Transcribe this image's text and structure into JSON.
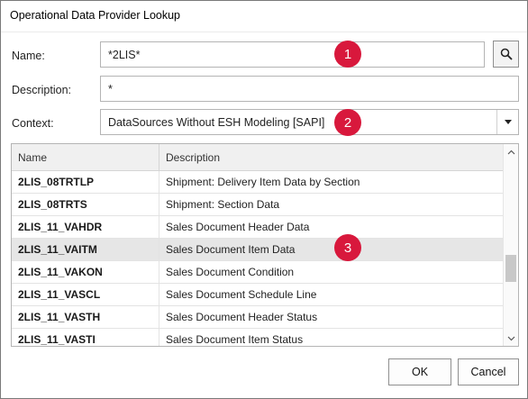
{
  "window": {
    "title": "Operational Data Provider Lookup"
  },
  "form": {
    "name_label": "Name:",
    "name_value": "*2LIS*",
    "description_label": "Description:",
    "description_value": "*",
    "context_label": "Context:",
    "context_value": "DataSources Without ESH Modeling [SAPI]"
  },
  "badges": [
    "1",
    "2",
    "3"
  ],
  "grid": {
    "columns": [
      "Name",
      "Description"
    ],
    "rows": [
      {
        "name": "2LIS_08TRTLP",
        "description": "Shipment: Delivery Item Data by Section"
      },
      {
        "name": "2LIS_08TRTS",
        "description": "Shipment: Section Data"
      },
      {
        "name": "2LIS_11_VAHDR",
        "description": "Sales Document Header Data"
      },
      {
        "name": "2LIS_11_VAITM",
        "description": "Sales Document Item Data",
        "selected": true
      },
      {
        "name": "2LIS_11_VAKON",
        "description": "Sales Document Condition"
      },
      {
        "name": "2LIS_11_VASCL",
        "description": "Sales Document Schedule Line"
      },
      {
        "name": "2LIS_11_VASTH",
        "description": "Sales Document Header Status"
      },
      {
        "name": "2LIS_11_VASTI",
        "description": "Sales Document Item Status"
      }
    ]
  },
  "buttons": {
    "ok": "OK",
    "cancel": "Cancel"
  },
  "icons": {
    "search": "search-icon",
    "dropdown": "chevron-down-icon"
  },
  "colors": {
    "badge": "#d8183c",
    "selected_row": "#e6e6e6"
  }
}
